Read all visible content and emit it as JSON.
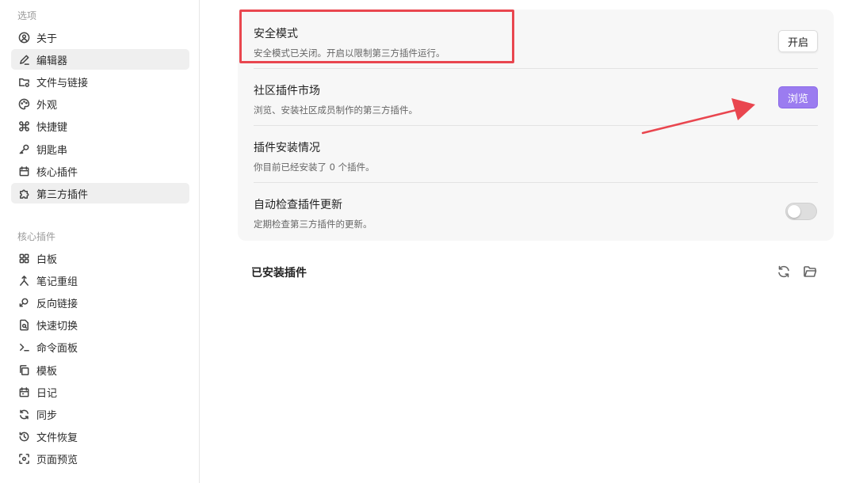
{
  "sidebar": {
    "options_title": "选项",
    "options": [
      {
        "label": "关于",
        "icon": "info-circle-icon"
      },
      {
        "label": "编辑器",
        "icon": "pencil-icon",
        "active": true
      },
      {
        "label": "文件与链接",
        "icon": "folder-link-icon"
      },
      {
        "label": "外观",
        "icon": "palette-icon"
      },
      {
        "label": "快捷键",
        "icon": "command-icon"
      },
      {
        "label": "钥匙串",
        "icon": "key-icon"
      },
      {
        "label": "核心插件",
        "icon": "calendar-icon"
      },
      {
        "label": "第三方插件",
        "icon": "puzzle-icon",
        "active": true
      }
    ],
    "core_title": "核心插件",
    "core": [
      {
        "label": "白板",
        "icon": "layout-grid-icon"
      },
      {
        "label": "笔记重组",
        "icon": "merge-icon"
      },
      {
        "label": "反向链接",
        "icon": "backlink-icon"
      },
      {
        "label": "快速切换",
        "icon": "file-search-icon"
      },
      {
        "label": "命令面板",
        "icon": "terminal-icon"
      },
      {
        "label": "模板",
        "icon": "copy-icon"
      },
      {
        "label": "日记",
        "icon": "calendar-day-icon"
      },
      {
        "label": "同步",
        "icon": "sync-icon"
      },
      {
        "label": "文件恢复",
        "icon": "history-icon"
      },
      {
        "label": "页面预览",
        "icon": "preview-icon"
      }
    ]
  },
  "main": {
    "safe_mode": {
      "title": "安全模式",
      "desc": "安全模式已关闭。开启以限制第三方插件运行。",
      "button": "开启"
    },
    "market": {
      "title": "社区插件市场",
      "desc": "浏览、安装社区成员制作的第三方插件。",
      "button": "浏览"
    },
    "install_status": {
      "title": "插件安装情况",
      "desc": "你目前已经安装了 0 个插件。"
    },
    "auto_update": {
      "title": "自动检查插件更新",
      "desc": "定期检查第三方插件的更新。",
      "enabled": false
    },
    "installed_title": "已安装插件"
  },
  "colors": {
    "accent": "#9b7cf0",
    "annotation": "#e9464f"
  }
}
